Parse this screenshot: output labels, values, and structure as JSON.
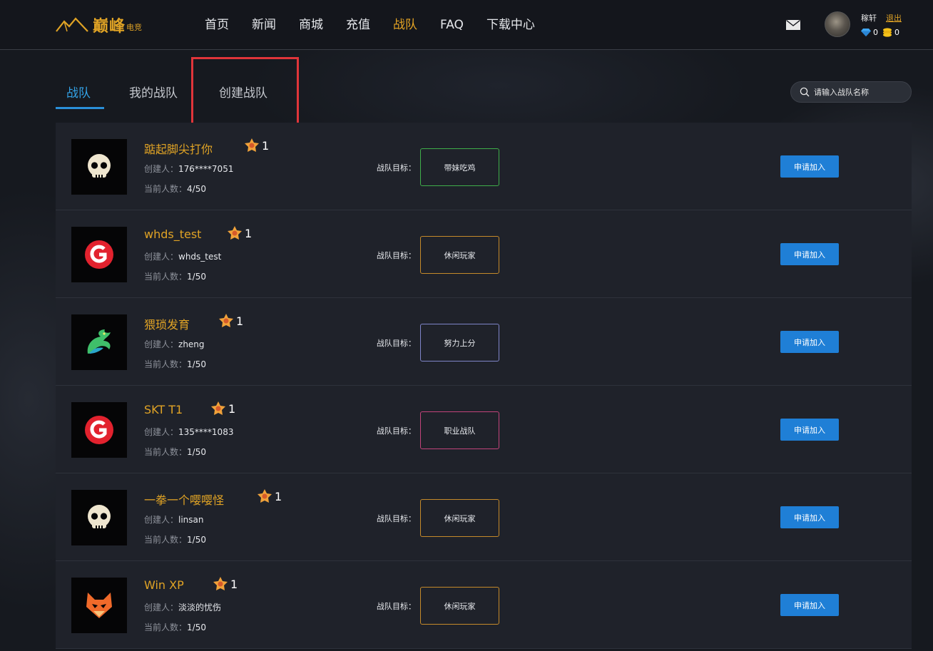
{
  "header": {
    "logo_text": "巅峰",
    "logo_sub": "电竞",
    "nav": [
      {
        "label": "首页",
        "active": false
      },
      {
        "label": "新闻",
        "active": false
      },
      {
        "label": "商城",
        "active": false
      },
      {
        "label": "充值",
        "active": false
      },
      {
        "label": "战队",
        "active": true
      },
      {
        "label": "FAQ",
        "active": false
      },
      {
        "label": "下载中心",
        "active": false
      }
    ],
    "user_name": "稼轩",
    "logout_label": "退出",
    "diamonds": "0",
    "coins": "0"
  },
  "tabs": [
    {
      "label": "战队",
      "active": true
    },
    {
      "label": "我的战队",
      "active": false
    },
    {
      "label": "创建战队",
      "active": false
    }
  ],
  "search": {
    "placeholder": "请输入战队名称"
  },
  "labels": {
    "creator_prefix": "创建人：",
    "count_prefix": "当前人数：",
    "goal_label": "战队目标：",
    "join_label": "申请加入"
  },
  "teams": [
    {
      "name": "踮起脚尖打你",
      "level": "1",
      "creator": "176****7051",
      "count": "4/50",
      "goal": "带妹吃鸡",
      "goal_color": "#3fae4a",
      "avatar": "skull-icon"
    },
    {
      "name": "whds_test",
      "level": "1",
      "creator": "whds_test",
      "count": "1/50",
      "goal": "休闲玩家",
      "goal_color": "#c58a2a",
      "avatar": "g-logo-icon"
    },
    {
      "name": "猥琐发育",
      "level": "1",
      "creator": "zheng",
      "count": "1/50",
      "goal": "努力上分",
      "goal_color": "#7f85c9",
      "avatar": "dragon-icon"
    },
    {
      "name": "SKT T1",
      "level": "1",
      "creator": "135****1083",
      "count": "1/50",
      "goal": "职业战队",
      "goal_color": "#c2447a",
      "avatar": "g-logo-icon"
    },
    {
      "name": "一拳一个嘤嘤怪",
      "level": "1",
      "creator": "linsan",
      "count": "1/50",
      "goal": "休闲玩家",
      "goal_color": "#c58a2a",
      "avatar": "skull-icon"
    },
    {
      "name": "Win XP",
      "level": "1",
      "creator": "淡淡的忧伤",
      "count": "1/50",
      "goal": "休闲玩家",
      "goal_color": "#c58a2a",
      "avatar": "fox-icon"
    }
  ]
}
